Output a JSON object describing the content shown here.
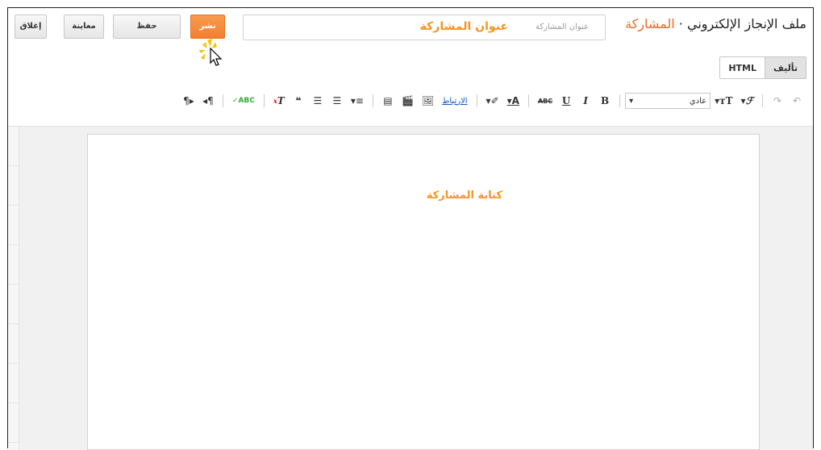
{
  "header": {
    "blog_name": "ملف الإنجاز الإلكتروني",
    "separator": "·",
    "section_label": "المشاركة",
    "title_input": {
      "placeholder": "عنوان المشاركة",
      "value": "عنوان المشاركة"
    },
    "buttons": {
      "publish": "نشر",
      "save": "حفظ",
      "preview": "معاينة",
      "close": "إغلاق"
    }
  },
  "mode_tabs": {
    "compose": "تأليف",
    "html": "HTML"
  },
  "toolbar": {
    "font_size": "عادي",
    "link_label": "الارتباط"
  },
  "editor": {
    "body_text": "كتابة المشاركة"
  },
  "colors": {
    "accent_orange": "#f7941d",
    "publish_button": "#f47f30",
    "section_label": "#f26522"
  },
  "icons": [
    "undo-icon",
    "redo-icon",
    "font-family-icon",
    "font-size-icon",
    "bold-icon",
    "italic-icon",
    "underline-icon",
    "strikethrough-icon",
    "text-color-icon",
    "highlight-icon",
    "image-icon",
    "video-icon",
    "jump-break-icon",
    "align-icon",
    "numbered-list-icon",
    "bullet-list-icon",
    "quote-icon",
    "remove-formatting-icon",
    "spellcheck-icon",
    "rtl-icon",
    "ltr-icon",
    "mouse-cursor-icon"
  ]
}
